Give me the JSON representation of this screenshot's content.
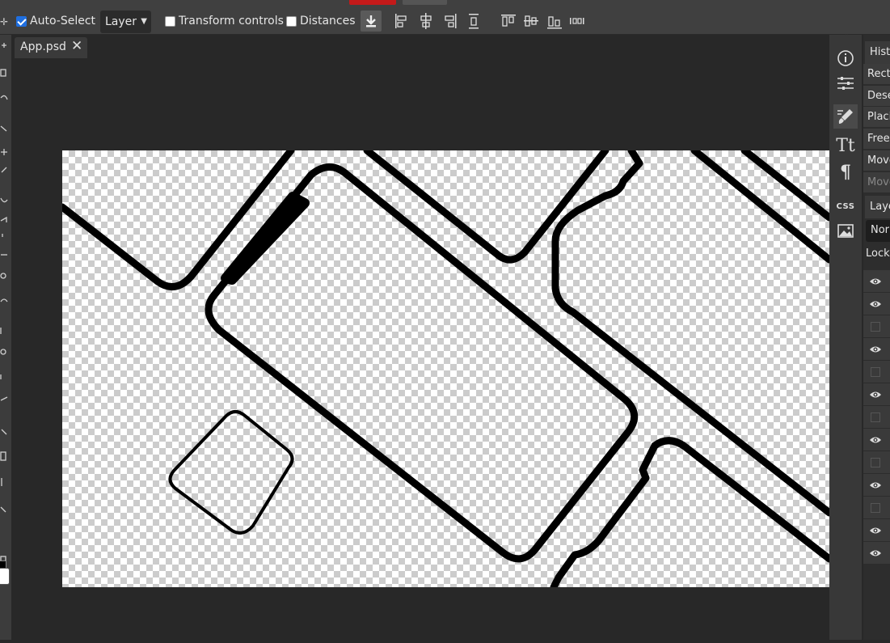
{
  "toolbar": {
    "auto_select_label": "Auto-Select",
    "auto_select_checked": true,
    "layer_select_value": "Layer",
    "transform_controls_label": "Transform controls",
    "transform_controls_checked": false,
    "distances_label": "Distances",
    "distances_checked": false
  },
  "document_tab": {
    "name": "App.psd",
    "close_glyph": "✕"
  },
  "right_icons": [
    "info-icon",
    "adjustments-icon",
    "brush-icon",
    "character-icon",
    "paragraph-icon",
    "css-icon",
    "image-icon"
  ],
  "right_icon_labels": {
    "character": "Tt",
    "paragraph": "¶",
    "css": "CSS"
  },
  "history_panel": {
    "title": "Histo",
    "items": [
      "Recta",
      "Dese",
      "Placi",
      "Free",
      "Move",
      "Move"
    ],
    "active_index": 4
  },
  "layers_panel": {
    "title": "Laye",
    "blend_mode": "Nor",
    "lock_label": "Lock:",
    "layer_visibility": [
      true,
      true,
      false,
      true,
      false,
      true,
      false,
      true,
      false,
      true,
      false,
      true,
      true
    ]
  },
  "colors": {
    "foreground": "#000000",
    "background": "#ffffff",
    "accent": "#1f6fe0"
  }
}
